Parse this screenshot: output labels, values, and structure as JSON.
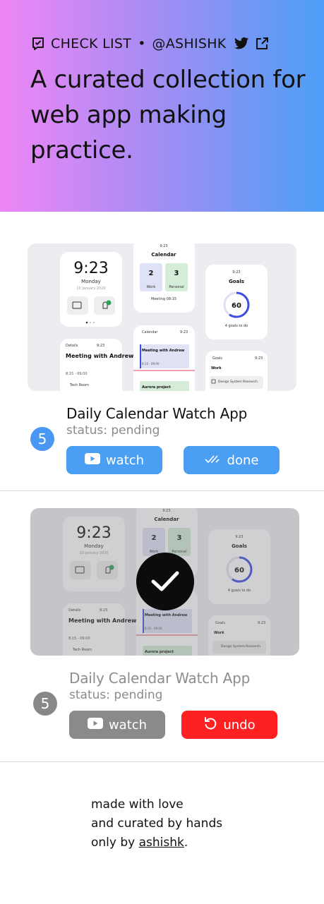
{
  "header": {
    "brand_name": "CHECK LIST",
    "separator": "•",
    "handle": "@ASHISHK",
    "tagline": "A curated collection for web app making practice.",
    "icons": [
      "checklist-icon",
      "twitter-icon",
      "external-link-icon"
    ],
    "gradient": [
      "#ef86f6",
      "#4c9ff6"
    ]
  },
  "items": [
    {
      "number": "5",
      "title": "Daily Calendar Watch App",
      "status": "status: pending",
      "watch_label": "watch",
      "action_label": "done",
      "completed": false,
      "thumbnail": {
        "time": "9:23",
        "day": "Monday",
        "date": "10 January 2020",
        "calendar_title": "Calendar",
        "calendar_time": "9:23",
        "work_count": "2",
        "work_label": "Work",
        "personal_count": "3",
        "personal_label": "Personal",
        "meeting_next": "Meeting 08:15",
        "goals_time": "9:23",
        "goals_title": "Goals",
        "goals_percent": "60",
        "goals_text": "4 goals to do",
        "details_label": "Details",
        "details_time": "9:23",
        "meeting_title": "Meeting with Andrew",
        "meeting_hours": "8:15 - 09:00",
        "room": "Tech Room",
        "calendar2_label": "Calendar",
        "calendar2_time": "9:23",
        "event_title": "Meeting with Andrew",
        "event_hours": "8:15 - 09:00",
        "aurora": "Aurora project",
        "goals2_label": "Goals",
        "goals2_time": "9:23",
        "goals2_section": "Work",
        "goals2_item": "Design System Research"
      }
    },
    {
      "number": "5",
      "title": "Daily Calendar Watch App",
      "status": "status: pending",
      "watch_label": "watch",
      "action_label": "undo",
      "completed": true
    }
  ],
  "colors": {
    "primary": "#4a9ff3",
    "undo": "#ff2121",
    "muted": "#8a8a8a"
  },
  "footer": {
    "line1": "made with love",
    "line2": "and curated by hands",
    "line3_prefix": "only by ",
    "author": "ashishk",
    "line3_suffix": "."
  }
}
